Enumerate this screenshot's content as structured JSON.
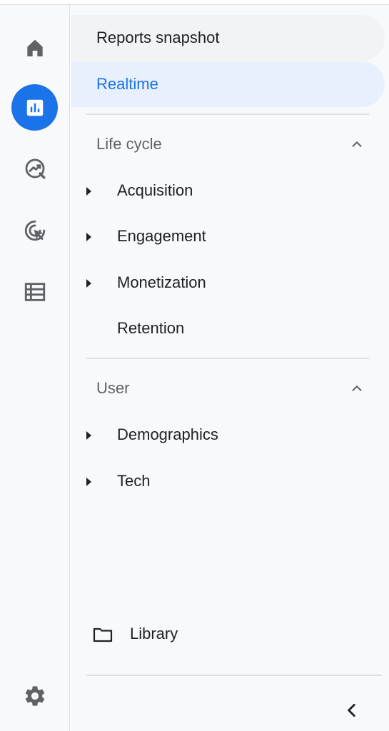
{
  "rail": {
    "items": [
      {
        "icon": "home-icon",
        "active": false
      },
      {
        "icon": "reports-icon",
        "active": true
      },
      {
        "icon": "explore-icon",
        "active": false
      },
      {
        "icon": "advertising-icon",
        "active": false
      },
      {
        "icon": "configure-icon",
        "active": false
      }
    ],
    "settings_icon": "gear-icon"
  },
  "nav": {
    "snapshot_label": "Reports snapshot",
    "realtime_label": "Realtime"
  },
  "sections": [
    {
      "title": "Life cycle",
      "expanded": true,
      "items": [
        {
          "label": "Acquisition",
          "has_children": true
        },
        {
          "label": "Engagement",
          "has_children": true
        },
        {
          "label": "Monetization",
          "has_children": true
        },
        {
          "label": "Retention",
          "has_children": false
        }
      ]
    },
    {
      "title": "User",
      "expanded": true,
      "items": [
        {
          "label": "Demographics",
          "has_children": true
        },
        {
          "label": "Tech",
          "has_children": true
        }
      ]
    }
  ],
  "library": {
    "label": "Library",
    "icon": "folder-icon"
  },
  "collapse": {
    "icon": "chevron-left-icon"
  },
  "colors": {
    "accent": "#1a73e8",
    "active_bg": "#e8f0fe",
    "hover_bg": "#f1f3f4",
    "panel_bg": "#f8f9fa",
    "text_primary": "#202124",
    "text_secondary": "#5f6368"
  }
}
